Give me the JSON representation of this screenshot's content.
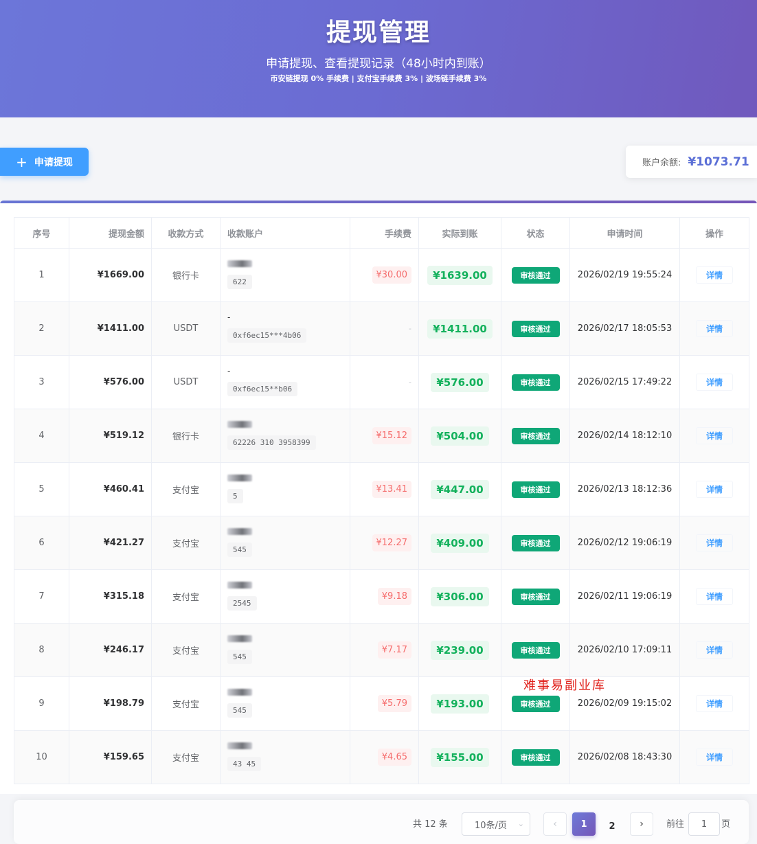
{
  "header": {
    "title": "提现管理",
    "subtitle": "申请提现、查看提现记录（48小时内到账）",
    "fees": "币安链提现 0% 手续费 | 支付宝手续费 3% | 波场链手续费 3%"
  },
  "toolbar": {
    "apply_label": "申请提现",
    "balance_label": "账户余额:",
    "balance_value": "¥1073.71"
  },
  "table": {
    "columns": [
      "序号",
      "提现金额",
      "收款方式",
      "收款账户",
      "手续费",
      "实际到账",
      "状态",
      "申请时间",
      "操作"
    ],
    "rows": [
      {
        "idx": "1",
        "amount": "¥1669.00",
        "method": "银行卡",
        "name_prefix": "",
        "account": "622",
        "fee": "¥30.00",
        "real": "¥1639.00",
        "status": "审核通过",
        "time": "2026/02/19 19:55:24",
        "op": "详情"
      },
      {
        "idx": "2",
        "amount": "¥1411.00",
        "method": "USDT",
        "name_prefix": "-",
        "account": "0xf6ec15***4b06",
        "fee": "-",
        "real": "¥1411.00",
        "status": "审核通过",
        "time": "2026/02/17 18:05:53",
        "op": "详情"
      },
      {
        "idx": "3",
        "amount": "¥576.00",
        "method": "USDT",
        "name_prefix": "-",
        "account": "0xf6ec15**b06",
        "fee": "-",
        "real": "¥576.00",
        "status": "审核通过",
        "time": "2026/02/15 17:49:22",
        "op": "详情"
      },
      {
        "idx": "4",
        "amount": "¥519.12",
        "method": "银行卡",
        "name_prefix": "",
        "account": "62226 310 3958399",
        "fee": "¥15.12",
        "real": "¥504.00",
        "status": "审核通过",
        "time": "2026/02/14 18:12:10",
        "op": "详情"
      },
      {
        "idx": "5",
        "amount": "¥460.41",
        "method": "支付宝",
        "name_prefix": "",
        "account": "5",
        "fee": "¥13.41",
        "real": "¥447.00",
        "status": "审核通过",
        "time": "2026/02/13 18:12:36",
        "op": "详情"
      },
      {
        "idx": "6",
        "amount": "¥421.27",
        "method": "支付宝",
        "name_prefix": "",
        "account": "545",
        "fee": "¥12.27",
        "real": "¥409.00",
        "status": "审核通过",
        "time": "2026/02/12 19:06:19",
        "op": "详情"
      },
      {
        "idx": "7",
        "amount": "¥315.18",
        "method": "支付宝",
        "name_prefix": "",
        "account": "2545",
        "fee": "¥9.18",
        "real": "¥306.00",
        "status": "审核通过",
        "time": "2026/02/11 19:06:19",
        "op": "详情"
      },
      {
        "idx": "8",
        "amount": "¥246.17",
        "method": "支付宝",
        "name_prefix": "",
        "account": "545",
        "fee": "¥7.17",
        "real": "¥239.00",
        "status": "审核通过",
        "time": "2026/02/10 17:09:11",
        "op": "详情"
      },
      {
        "idx": "9",
        "amount": "¥198.79",
        "method": "支付宝",
        "name_prefix": "",
        "account": "545",
        "fee": "¥5.79",
        "real": "¥193.00",
        "status": "审核通过",
        "time": "2026/02/09 19:15:02",
        "op": "详情"
      },
      {
        "idx": "10",
        "amount": "¥159.65",
        "method": "支付宝",
        "name_prefix": "",
        "account": "43 45",
        "fee": "¥4.65",
        "real": "¥155.00",
        "status": "审核通过",
        "time": "2026/02/08 18:43:30",
        "op": "详情"
      }
    ]
  },
  "watermark": "难事易副业库",
  "pagination": {
    "total": "共 12 条",
    "page_size": "10条/页",
    "current_page": "1",
    "page_two": "2",
    "goto_label": "前往",
    "goto_value": "1",
    "page_suffix": "页"
  }
}
